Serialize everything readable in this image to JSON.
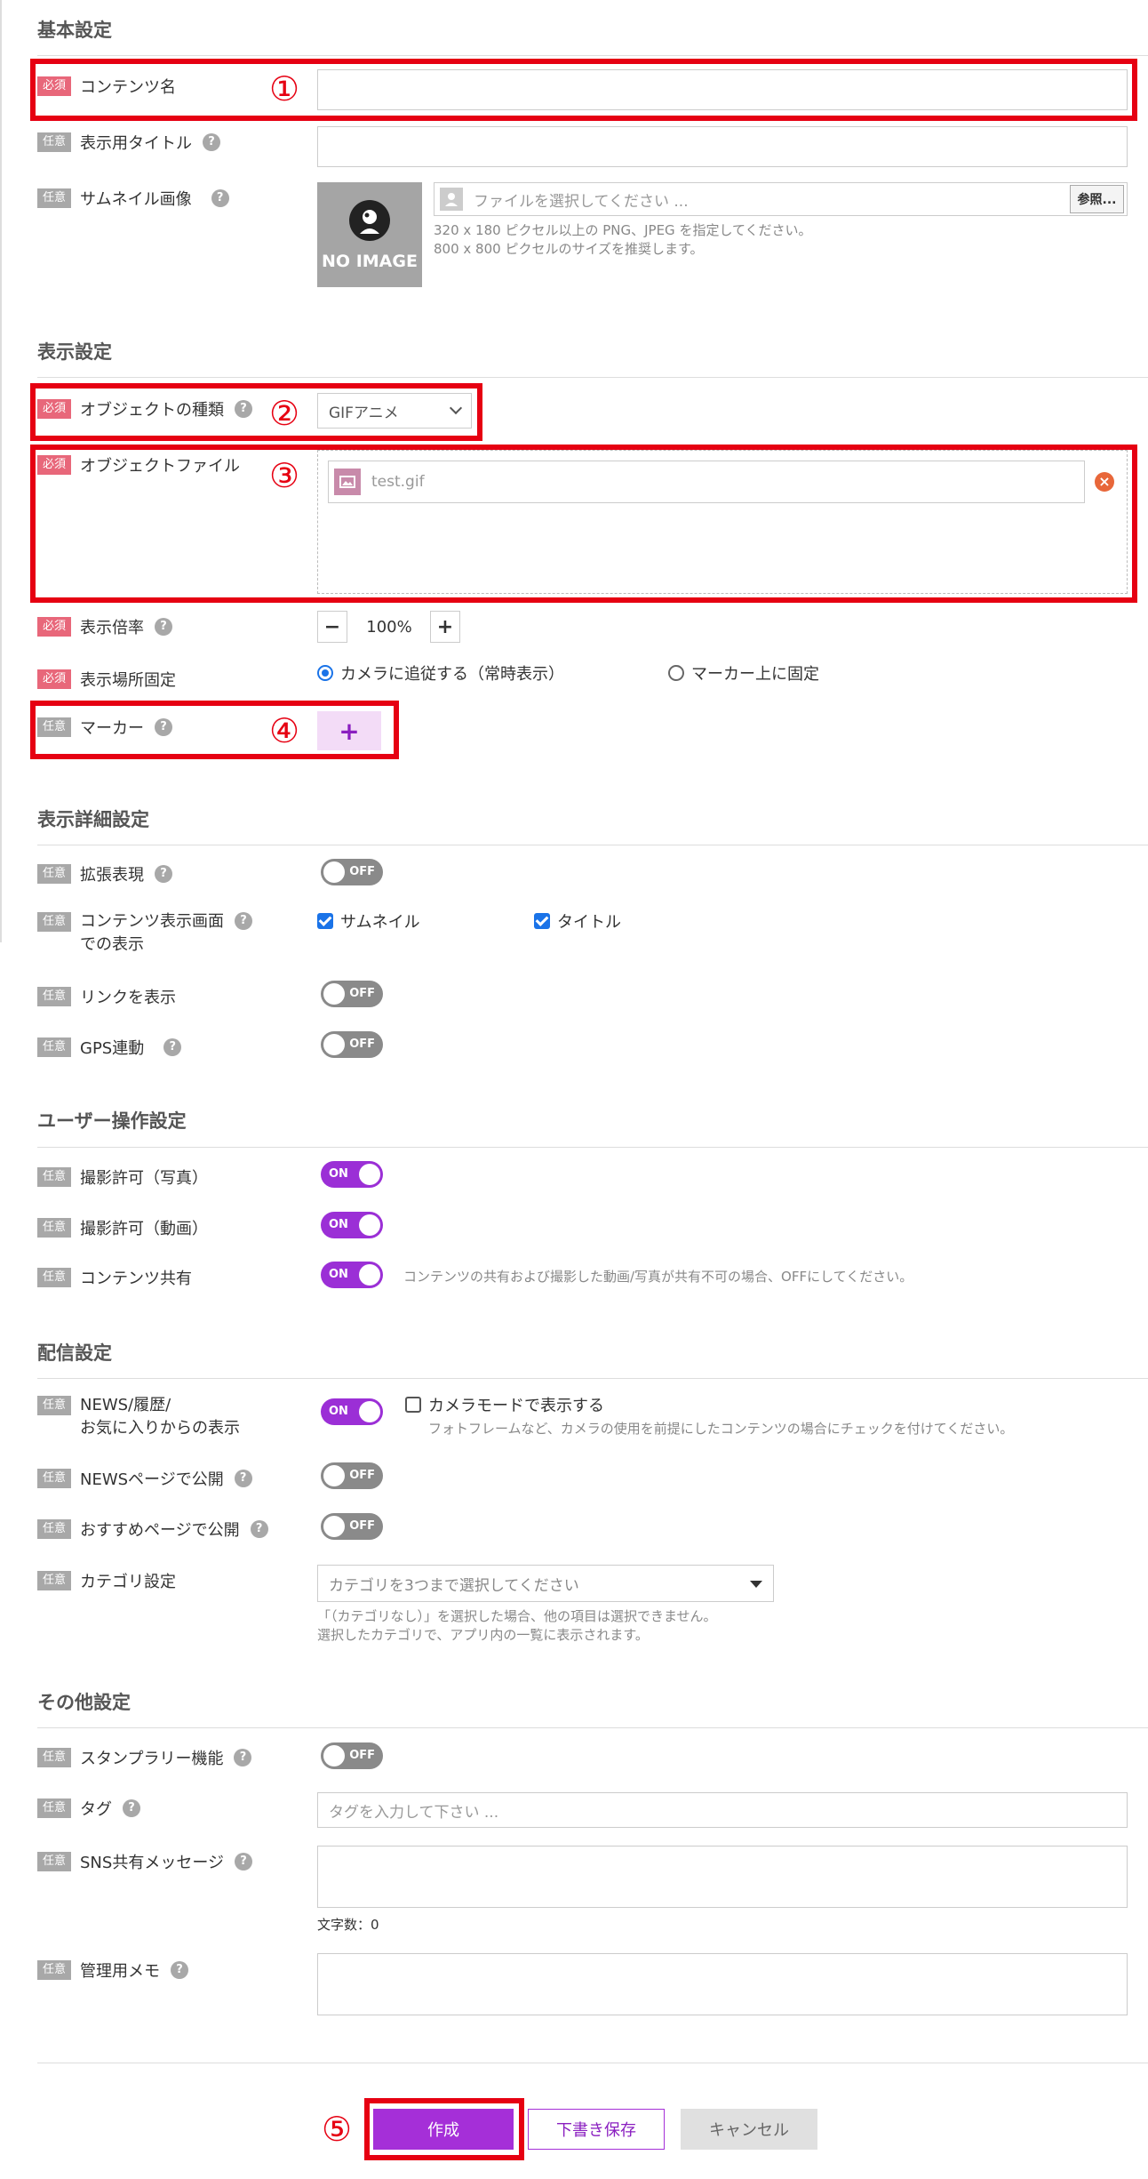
{
  "sections": {
    "basic": "基本設定",
    "display": "表示設定",
    "display_detail": "表示詳細設定",
    "user_ops": "ユーザー操作設定",
    "delivery": "配信設定",
    "other": "その他設定"
  },
  "badges": {
    "required": "必須",
    "optional": "任意"
  },
  "help_glyph": "?",
  "basic": {
    "content_name_label": "コンテンツ名",
    "content_name_value": "",
    "display_title_label": "表示用タイトル",
    "display_title_value": "",
    "thumbnail_label": "サムネイル画像",
    "no_image_text": "NO IMAGE",
    "file_placeholder": "ファイルを選択してください ...",
    "browse_button": "参照...",
    "thumbnail_hint_1": "320 x 180 ピクセル以上の PNG、JPEG を指定してください。",
    "thumbnail_hint_2": "800 x 800 ピクセルのサイズを推奨します。"
  },
  "display": {
    "object_type_label": "オブジェクトの種類",
    "object_type_value": "GIFアニメ",
    "object_file_label": "オブジェクトファイル",
    "object_file_name": "test.gif",
    "scale_label": "表示倍率",
    "scale_minus": "−",
    "scale_value": "100%",
    "scale_plus": "+",
    "location_label": "表示場所固定",
    "location_options": [
      "カメラに追従する（常時表示）",
      "マーカー上に固定"
    ],
    "location_selected": 0,
    "marker_label": "マーカー",
    "marker_add": "+"
  },
  "detail": {
    "extended_label": "拡張表現",
    "extended_state": "OFF",
    "content_screen_label_1": "コンテンツ表示画面",
    "content_screen_label_2": "での表示",
    "thumbnail_check": "サムネイル",
    "thumbnail_checked": true,
    "title_check": "タイトル",
    "title_checked": true,
    "link_label": "リンクを表示",
    "link_state": "OFF",
    "gps_label": "GPS連動",
    "gps_state": "OFF"
  },
  "user_ops": {
    "photo_label": "撮影許可（写真）",
    "photo_state": "ON",
    "video_label": "撮影許可（動画）",
    "video_state": "ON",
    "share_label": "コンテンツ共有",
    "share_state": "ON",
    "share_hint": "コンテンツの共有および撮影した動画/写真が共有不可の場合、OFFにしてください。"
  },
  "delivery": {
    "news_label_1": "NEWS/履歴/",
    "news_label_2": "お気に入りからの表示",
    "news_state": "ON",
    "camera_mode_check": "カメラモードで表示する",
    "camera_mode_checked": false,
    "camera_mode_hint": "フォトフレームなど、カメラの使用を前提にしたコンテンツの場合にチェックを付けてください。",
    "news_page_label": "NEWSページで公開",
    "news_page_state": "OFF",
    "recommend_label": "おすすめページで公開",
    "recommend_state": "OFF",
    "category_label": "カテゴリ設定",
    "category_placeholder": "カテゴリを3つまで選択してください",
    "category_hint_1": "「（カテゴリなし）」を選択した場合、他の項目は選択できません。",
    "category_hint_2": "選択したカテゴリで、アプリ内の一覧に表示されます。"
  },
  "other": {
    "stamp_label": "スタンプラリー機能",
    "stamp_state": "OFF",
    "tag_label": "タグ",
    "tag_placeholder": "タグを入力して下さい ...",
    "sns_label": "SNS共有メッセージ",
    "sns_value": "",
    "char_count": "文字数：0",
    "memo_label": "管理用メモ",
    "memo_value": ""
  },
  "actions": {
    "create": "作成",
    "save_draft": "下書き保存",
    "cancel": "キャンセル"
  },
  "annotations": [
    "①",
    "②",
    "③",
    "④",
    "⑤"
  ],
  "colors": {
    "required_badge": "#e8677a",
    "optional_badge": "#a8a8a8",
    "toggle_on": "#9b2fd6",
    "toggle_off": "#8a8a8a",
    "annotation_red": "#e60012",
    "accent_purple": "#a52fd8"
  }
}
